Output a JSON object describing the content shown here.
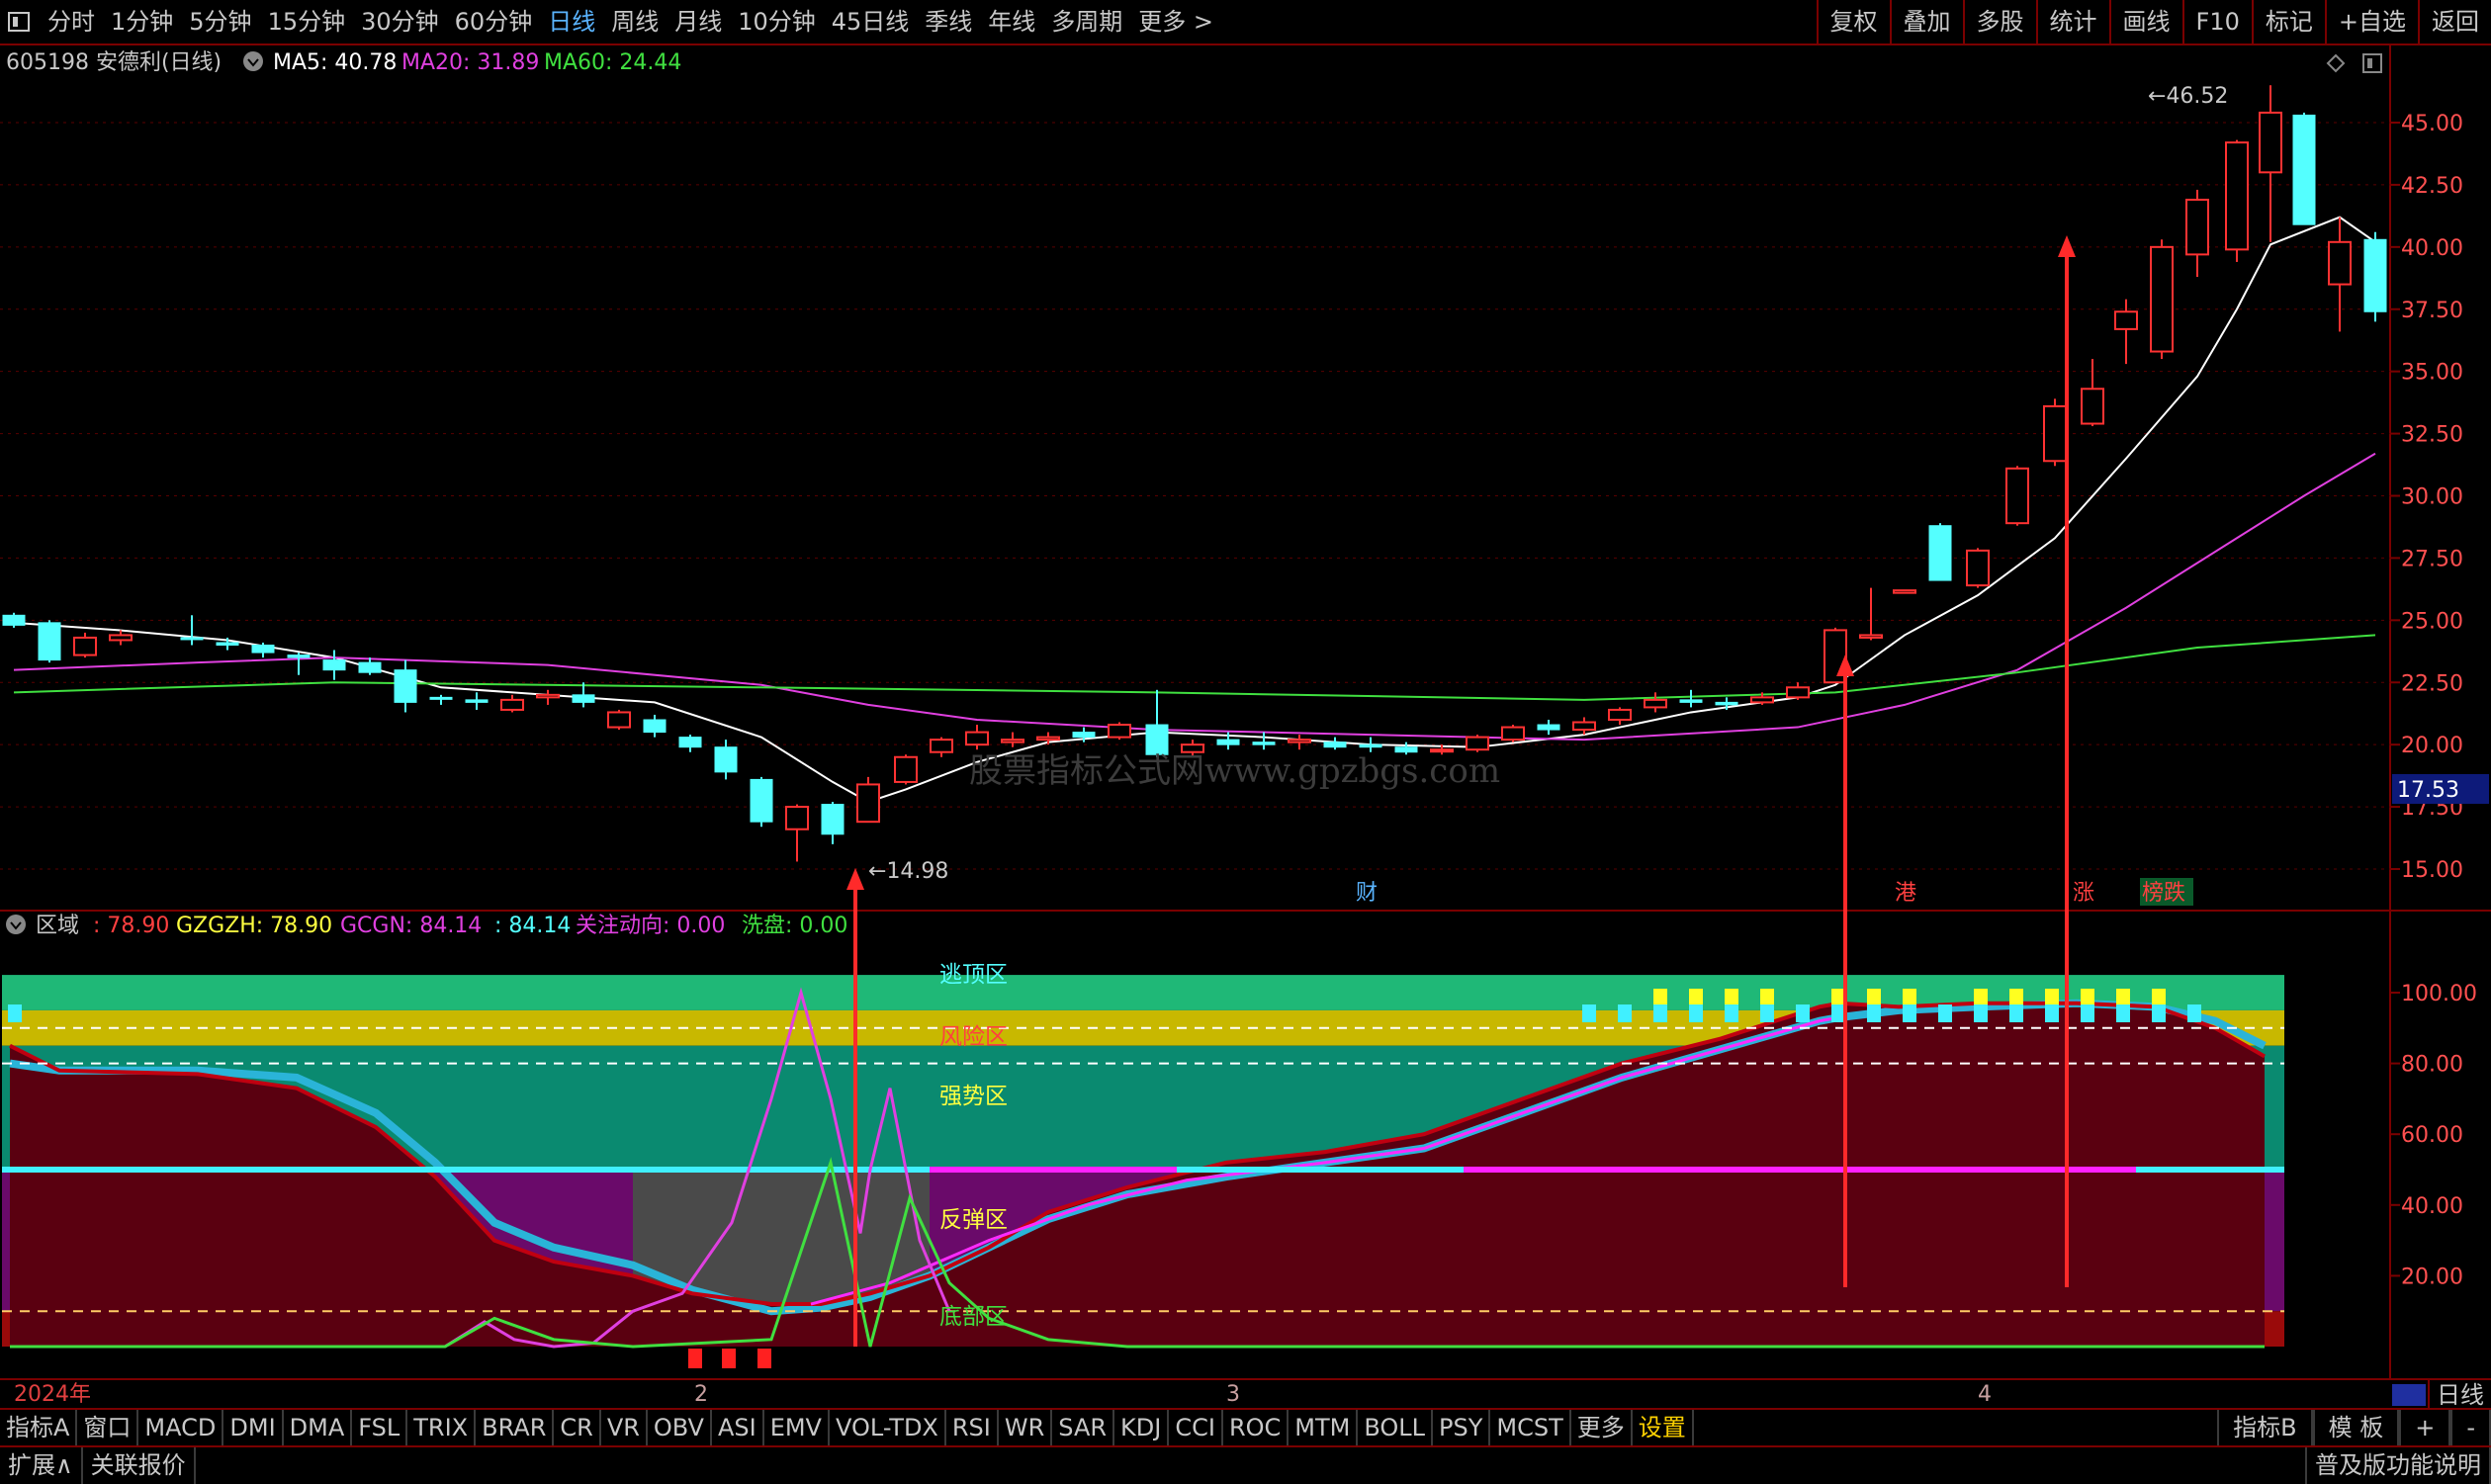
{
  "period_bar": {
    "items": [
      "分时",
      "1分钟",
      "5分钟",
      "15分钟",
      "30分钟",
      "60分钟",
      "日线",
      "周线",
      "月线",
      "10分钟",
      "45日线",
      "季线",
      "年线",
      "多周期",
      "更多 >"
    ],
    "active": "日线",
    "right_items": [
      "复权",
      "叠加",
      "多股",
      "统计",
      "画线",
      "F10",
      "标记",
      "+自选",
      "返回"
    ]
  },
  "main_header": {
    "title": "605198 安德利(日线)",
    "ma5_label": "MA5: 40.78",
    "ma20_label": "MA20: 31.89",
    "ma60_label": "MA60: 24.44",
    "ma5_color": "#ffffff",
    "ma20_color": "#e040e0",
    "ma60_color": "#40e040"
  },
  "price_axis": {
    "ticks": [
      "45.00",
      "42.50",
      "40.00",
      "37.50",
      "35.00",
      "32.50",
      "30.00",
      "27.50",
      "25.00",
      "22.50",
      "20.00",
      "17.50",
      "15.00"
    ],
    "current_price": "17.53"
  },
  "annotations": {
    "high_label": "46.52",
    "low_label": "14.98",
    "watermark": "股票指标公式网www.gpzbgs.com",
    "event_badges": [
      "财",
      "港",
      "涨",
      "榜跌"
    ]
  },
  "indicator_header": {
    "name": "区域",
    "value1": ": 78.90",
    "gzgzh": "GZGZH: 78.90",
    "gcgn": "GCGN: 84.14",
    "value2": ": 84.14",
    "attention": "关注动向: 0.00",
    "wash": "洗盘: 0.00"
  },
  "indicator_axis": {
    "ticks": [
      "100.00",
      "80.00",
      "60.00",
      "40.00",
      "20.00"
    ]
  },
  "zone_labels": [
    "逃顶区",
    "风险区",
    "强势区",
    "反弹区",
    "底部区"
  ],
  "timeline": {
    "year_label": "2024年",
    "months": [
      "2",
      "3",
      "4"
    ],
    "day_button": "日线"
  },
  "bottom_tabs": {
    "left": [
      "指标A",
      "窗口",
      "MACD",
      "DMI",
      "DMA",
      "FSL",
      "TRIX",
      "BRAR",
      "CR",
      "VR",
      "OBV",
      "ASI",
      "EMV",
      "VOL-TDX",
      "RSI",
      "WR",
      "SAR",
      "KDJ",
      "CCI",
      "ROC",
      "MTM",
      "BOLL",
      "PSY",
      "MCST",
      "更多",
      "设置"
    ],
    "right": [
      "指标B",
      "模 板",
      "+",
      "-"
    ]
  },
  "status_bar": {
    "left": [
      "扩展∧",
      "关联报价"
    ],
    "right": "普及版功能说明"
  },
  "colors": {
    "up_candle": "#ff3232",
    "down_candle": "#54ffff",
    "frame": "#7a0000",
    "arrow": "#ff2a2a"
  }
}
